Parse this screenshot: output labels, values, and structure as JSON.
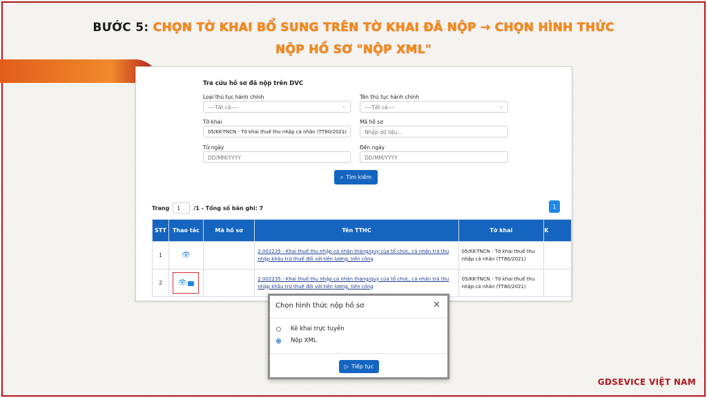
{
  "banner": {
    "line1_prefix": "BƯỚC 5:",
    "line1_highlight": "CHỌN TỜ KHAI BỔ SUNG TRÊN TỜ KHAI ĐÃ NỘP → CHỌN HÌNH THỨC",
    "line2": "NỘP HỒ SƠ \"NỘP XML\""
  },
  "search": {
    "title": "Tra cứu hồ sơ đã nộp trên DVC",
    "loai_label": "Loại thủ tục hành chính",
    "loai_value": "----Tất cả----",
    "ten_label": "Tên thủ tục hành chính",
    "ten_value": "----Tất cả----",
    "tokhai_label": "Tờ khai",
    "tokhai_value": "05/KK-TNCN - Tờ khai thuế thu nhập cá nhân (TT80/2021)",
    "mahoso_label": "Mã hồ sơ",
    "mahoso_placeholder": "Nhập dữ liệu...",
    "tungay_label": "Từ ngày",
    "tungay_placeholder": "DD/MM/YYYY",
    "denngay_label": "Đến ngày",
    "denngay_placeholder": "DD/MM/YYYY",
    "button": "Tìm kiếm"
  },
  "pager": {
    "trang_label": "Trang",
    "page": "1",
    "summary": "/1 - Tổng số bản ghi: 7",
    "page_button": "1"
  },
  "table": {
    "headers": [
      "STT",
      "Thao tác",
      "Mã hồ sơ",
      "Tên TTHC",
      "Tờ khai",
      "K"
    ],
    "rows": [
      {
        "stt": "1",
        "ten": "2.002235 - Khai thuế thu nhập cá nhân tháng/quý của tổ chức, cá nhân trả thu nhập khấu trừ thuế đối với tiền lương, tiền công",
        "tokhai": "05/KK-TNCN - Tờ khai thuế thu nhập cá nhân (TT80/2021)"
      },
      {
        "stt": "2",
        "ten": "2.002235 - Khai thuế thu nhập cá nhân tháng/quý của tổ chức, cá nhân trả thu nhập khấu trừ thuế đối với tiền lương, tiền công",
        "tokhai": "05/KK-TNCN - Tờ khai thuế thu nhập cá nhân (TT80/2021)"
      }
    ]
  },
  "modal": {
    "title": "Chọn hình thức nộp hồ sơ",
    "option1": "Kê khai trực tuyến",
    "option2": "Nộp XML",
    "selected": "Nộp XML",
    "button": "Tiếp tục"
  },
  "brand": "GDSEVICE VIỆT NAM",
  "colors": {
    "accent": "#1565c0",
    "brand_red": "#b0171c",
    "orange": "#f28c12"
  }
}
